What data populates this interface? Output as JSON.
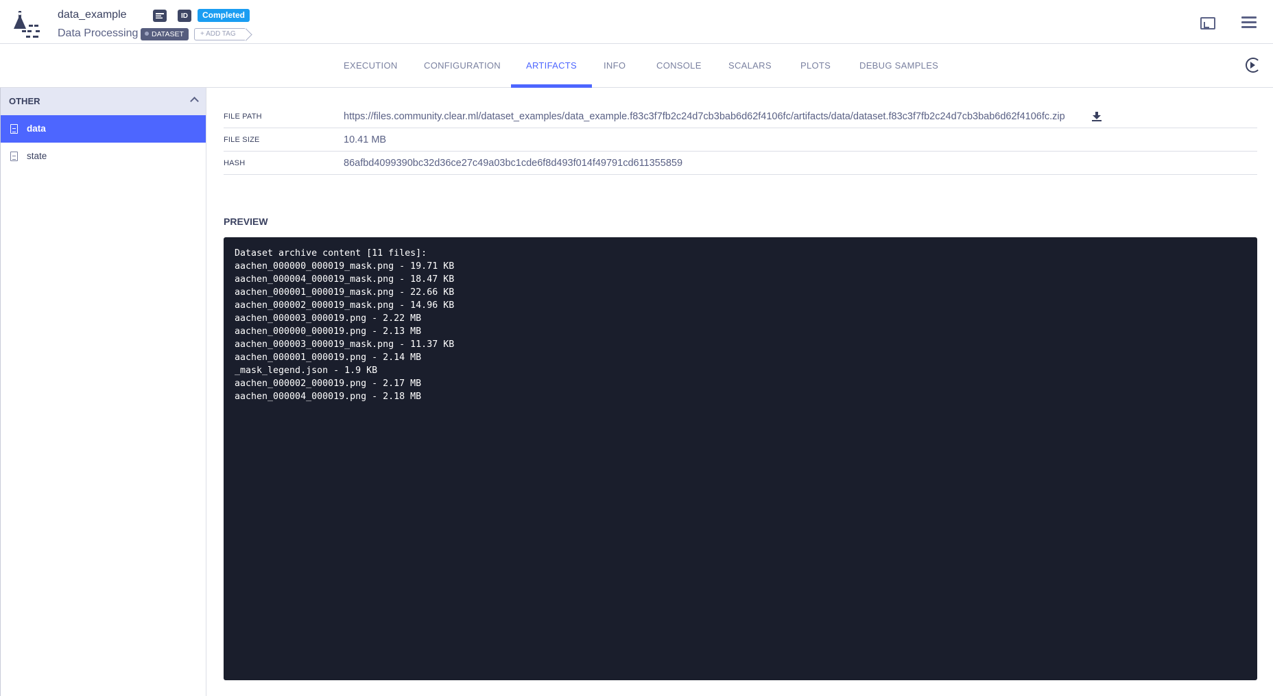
{
  "header": {
    "task_name": "data_example",
    "task_type": "Data Processing",
    "id_label": "ID",
    "status": "Completed",
    "tags": [
      "DATASET"
    ],
    "add_tag_label": "+ ADD TAG"
  },
  "tabs": [
    {
      "label": "EXECUTION",
      "active": false
    },
    {
      "label": "CONFIGURATION",
      "active": false
    },
    {
      "label": "ARTIFACTS",
      "active": true
    },
    {
      "label": "INFO",
      "active": false
    },
    {
      "label": "CONSOLE",
      "active": false
    },
    {
      "label": "SCALARS",
      "active": false
    },
    {
      "label": "PLOTS",
      "active": false
    },
    {
      "label": "DEBUG SAMPLES",
      "active": false
    }
  ],
  "sidebar": {
    "group_label": "OTHER",
    "items": [
      {
        "label": "data",
        "active": true
      },
      {
        "label": "state",
        "active": false
      }
    ]
  },
  "artifact": {
    "file_path_label": "FILE PATH",
    "file_path": "https://files.community.clear.ml/dataset_examples/data_example.f83c3f7fb2c24d7cb3bab6d62f4106fc/artifacts/data/dataset.f83c3f7fb2c24d7cb3bab6d62f4106fc.zip",
    "file_size_label": "FILE SIZE",
    "file_size": "10.41 MB",
    "hash_label": "HASH",
    "hash": "86afbd4099390bc32d36ce27c49a03bc1cde6f8d493f014f49791cd611355859"
  },
  "preview": {
    "title": "PREVIEW",
    "lines": [
      "Dataset archive content [11 files]:",
      "aachen_000000_000019_mask.png - 19.71 KB",
      "aachen_000004_000019_mask.png - 18.47 KB",
      "aachen_000001_000019_mask.png - 22.66 KB",
      "aachen_000002_000019_mask.png - 14.96 KB",
      "aachen_000003_000019.png - 2.22 MB",
      "aachen_000000_000019.png - 2.13 MB",
      "aachen_000003_000019_mask.png - 11.37 KB",
      "aachen_000001_000019.png - 2.14 MB",
      "_mask_legend.json - 1.9 KB",
      "aachen_000002_000019.png - 2.17 MB",
      "aachen_000004_000019.png - 2.18 MB"
    ]
  },
  "colors": {
    "accent": "#4d66ff",
    "status_completed": "#1a9df2",
    "preview_bg": "#1a1e2c"
  },
  "icons": [
    "app-logo-icon",
    "description-icon",
    "id-icon",
    "layout-toggle-icon",
    "menu-icon",
    "refresh-icon",
    "file-icon",
    "download-icon",
    "chevron-up-icon"
  ]
}
